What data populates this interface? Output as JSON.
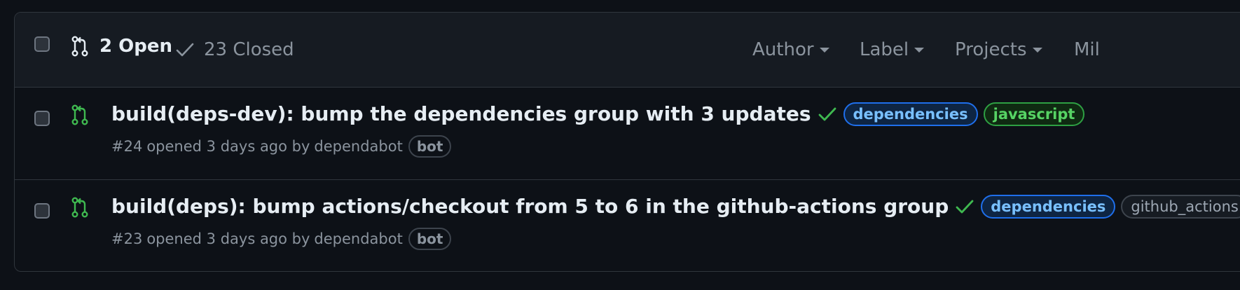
{
  "header": {
    "open_label": "2 Open",
    "closed_label": "23 Closed",
    "filters": [
      "Author",
      "Label",
      "Projects",
      "Mil"
    ]
  },
  "pulls": [
    {
      "title": "build(deps-dev): bump the dependencies group with 3 updates",
      "number": "#24",
      "opened_text": "opened 3 days ago by",
      "author": "dependabot",
      "badge": "bot",
      "labels": [
        "dependencies",
        "javascript"
      ]
    },
    {
      "title": "build(deps): bump actions/checkout from 5 to 6 in the github-actions group",
      "number": "#23",
      "opened_text": "opened 3 days ago by",
      "author": "dependabot",
      "badge": "bot",
      "labels": [
        "dependencies",
        "github_actions"
      ]
    }
  ],
  "colors": {
    "background": "#0d1117",
    "header_bg": "#161b22",
    "border": "#30363d",
    "open_pr_green": "#3fb950",
    "dependencies_label": "#1f6feb",
    "javascript_label": "#2ea043"
  },
  "icons": {
    "pr_open": "git-pull-request-icon",
    "check": "check-icon",
    "caret": "triangle-down-icon"
  }
}
